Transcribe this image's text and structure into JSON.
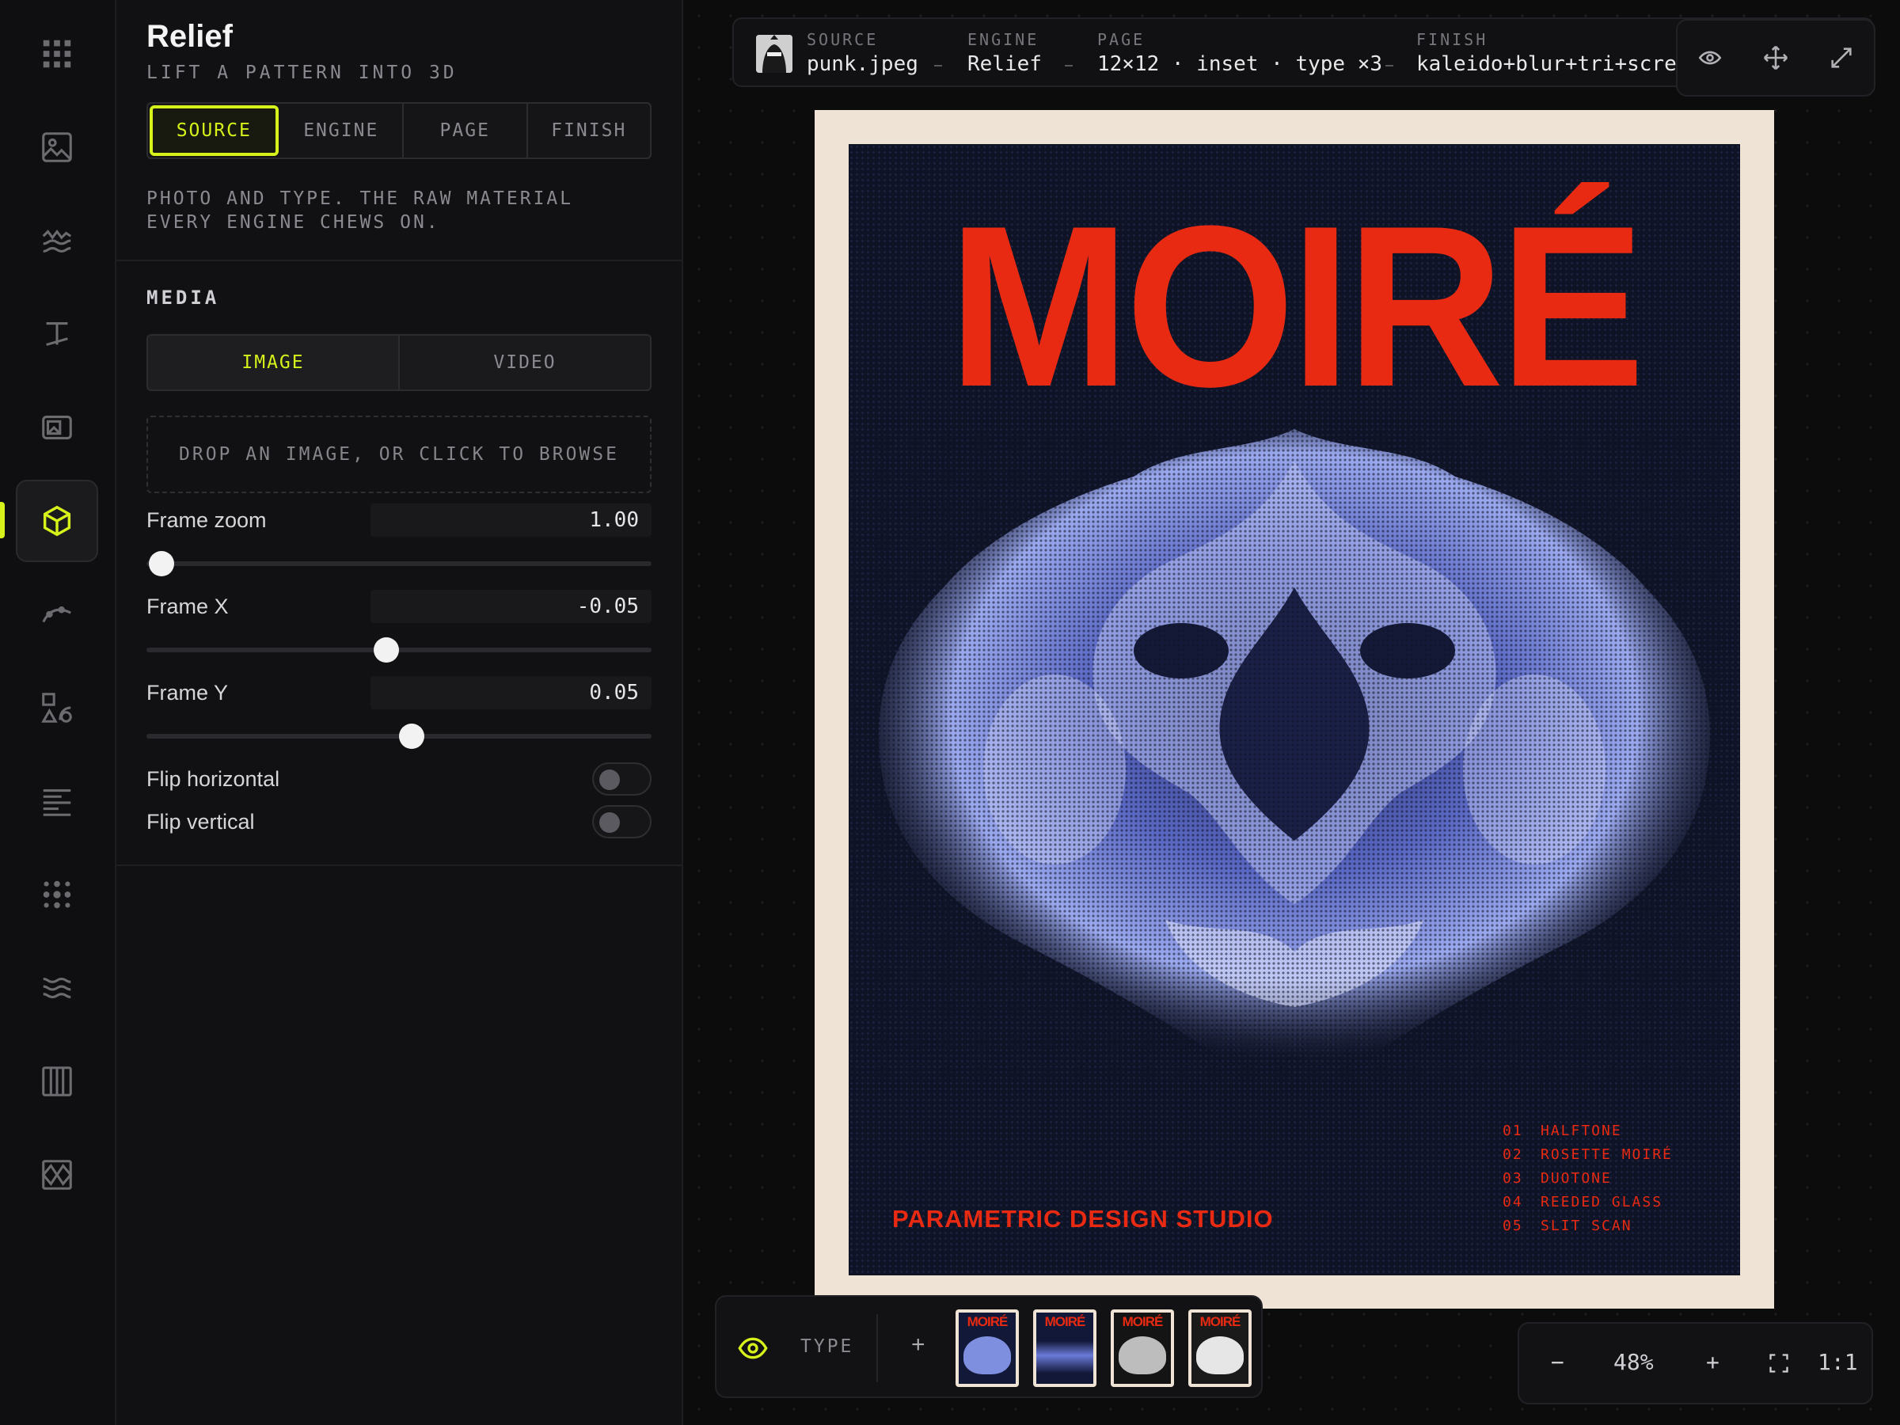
{
  "panel": {
    "title": "Relief",
    "subtitle": "LIFT A PATTERN INTO 3D",
    "tabs": [
      {
        "label": "SOURCE",
        "active": true
      },
      {
        "label": "ENGINE",
        "active": false
      },
      {
        "label": "PAGE",
        "active": false
      },
      {
        "label": "FINISH",
        "active": false
      }
    ],
    "description": "PHOTO AND TYPE. THE RAW MATERIAL EVERY ENGINE CHEWS ON.",
    "media": {
      "title": "MEDIA",
      "segments": [
        {
          "label": "IMAGE",
          "active": true
        },
        {
          "label": "VIDEO",
          "active": false
        }
      ],
      "drop_text": "DROP AN IMAGE, OR CLICK TO BROWSE",
      "frame_zoom": {
        "label": "Frame zoom",
        "value": "1.00",
        "slider_fraction": 0.03
      },
      "frame_x": {
        "label": "Frame X",
        "value": "-0.05",
        "slider_fraction": 0.475
      },
      "frame_y": {
        "label": "Frame Y",
        "value": "0.05",
        "slider_fraction": 0.525
      },
      "flip_horizontal": {
        "label": "Flip horizontal",
        "on": false
      },
      "flip_vertical": {
        "label": "Flip vertical",
        "on": false
      }
    }
  },
  "rail": {
    "icons": [
      "grid-icon",
      "image-icon",
      "waves-icon",
      "type-icon",
      "photo-frame-icon",
      "cube-icon",
      "curve-icon",
      "shapes-icon",
      "lines-icon",
      "dots-icon",
      "ripple-icon",
      "columns-icon",
      "mesh-icon"
    ],
    "active_index": 5,
    "accent": "#d6f21a"
  },
  "topbar": {
    "crumbs": [
      {
        "key": "SOURCE",
        "value": "punk.jpeg"
      },
      {
        "key": "ENGINE",
        "value": "Relief"
      },
      {
        "key": "PAGE",
        "value": "12×12 · inset · type ×3"
      },
      {
        "key": "FINISH",
        "value": "kaleido+blur+tri+screen"
      }
    ],
    "tools": [
      "eye-orbit-icon",
      "move-icon",
      "expand-icon"
    ]
  },
  "poster": {
    "title": "MOIRÉ",
    "studio": "PARAMETRIC DESIGN STUDIO",
    "list": [
      {
        "n": "01",
        "label": "HALFTONE"
      },
      {
        "n": "02",
        "label": "ROSETTE MOIRÉ"
      },
      {
        "n": "03",
        "label": "DUOTONE"
      },
      {
        "n": "04",
        "label": "REEDED GLASS"
      },
      {
        "n": "05",
        "label": "SLIT SCAN"
      }
    ],
    "colors": {
      "accent": "#e82a12",
      "paper": "#efe3d6",
      "ink": "#0f1326",
      "art": "#6f7fd8"
    }
  },
  "variants": {
    "type_label": "TYPE",
    "add_label": "+",
    "thumbs": [
      {
        "title": "MOIRÉ",
        "style": "blue"
      },
      {
        "title": "MOIRÉ",
        "style": "gradient"
      },
      {
        "title": "MOIRÉ",
        "style": "mono-dark"
      },
      {
        "title": "MOIRÉ",
        "style": "mono-light"
      }
    ]
  },
  "zoom": {
    "minus": "−",
    "value": "48%",
    "plus": "+",
    "fit_icon": "fit-icon",
    "actual": "1:1"
  }
}
